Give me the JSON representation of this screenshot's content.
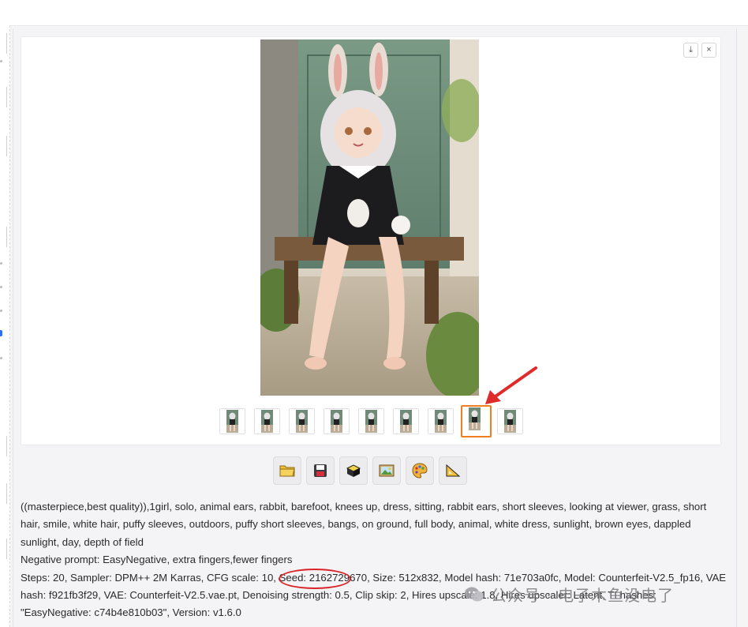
{
  "gallery": {
    "download_label": "⤓",
    "close_label": "×",
    "thumbnail_count": 9,
    "selected_thumbnail_index": 7
  },
  "toolbar": {
    "buttons": [
      {
        "name": "open-folder-button",
        "icon": "folder-icon"
      },
      {
        "name": "save-button",
        "icon": "floppy-disk-icon"
      },
      {
        "name": "zip-button",
        "icon": "zip-box-icon"
      },
      {
        "name": "send-to-img2img-button",
        "icon": "picture-icon"
      },
      {
        "name": "send-to-inpaint-button",
        "icon": "palette-icon"
      },
      {
        "name": "send-to-extras-button",
        "icon": "triangle-ruler-icon"
      }
    ]
  },
  "generation_info": {
    "prompt": "((masterpiece,best quality)),1girl, solo, animal ears, rabbit, barefoot, knees up, dress, sitting, rabbit ears, short sleeves, looking at viewer, grass, short hair, smile, white hair, puffy sleeves, outdoors, puffy short sleeves, bangs, on ground, full body, animal, white dress, sunlight, brown eyes, dappled sunlight, day, depth of field",
    "negative_prompt": "Negative prompt: EasyNegative, extra fingers,fewer fingers",
    "params_before_seed": "Steps: 20, Sampler: DPM++ 2M Karras, CFG scale: 10, Seed: ",
    "seed": "2162729670",
    "params_after_seed": ", Size: 512x832, Model hash: 71e703a0fc, Model: Counterfeit-V2.5_fp16, VAE hash: f921fb3f29, VAE: Counterfeit-V2.5.vae.pt, Denoising strength: 0.5, Clip skip: 2, Hires upscale: 1.8, Hires upscaler: Latent, TI hashes: \"EasyNegative: c74b4e810b03\", Version: v1.6.0"
  },
  "watermark": {
    "text": "公众号 · 电子木鱼没电了"
  },
  "colors": {
    "accent_orange": "#f07d1f",
    "annotation_red": "#d9252a",
    "link_blue": "#2b6fff"
  }
}
